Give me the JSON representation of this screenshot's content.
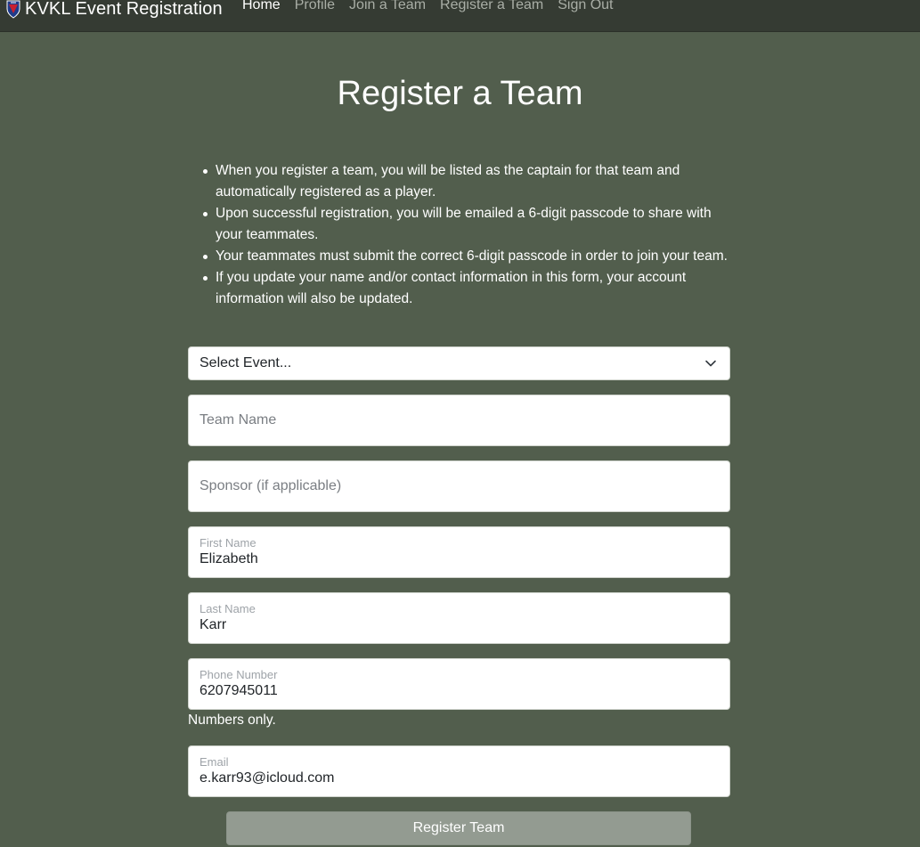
{
  "navbar": {
    "brand": "KVKL Event Registration",
    "links": [
      {
        "label": "Home",
        "active": true
      },
      {
        "label": "Profile"
      },
      {
        "label": "Join a Team"
      },
      {
        "label": "Register a Team"
      },
      {
        "label": "Sign Out"
      }
    ]
  },
  "page": {
    "title": "Register a Team",
    "info": [
      "When you register a team, you will be listed as the captain for that team and automatically registered as a player.",
      "Upon successful registration, you will be emailed a 6-digit passcode to share with your teammates.",
      "Your teammates must submit the correct 6-digit passcode in order to join your team.",
      "If you update your name and/or contact information in this form, your account information will also be updated."
    ]
  },
  "form": {
    "event_select": {
      "selected": "Select Event..."
    },
    "team_name": {
      "placeholder": "Team Name",
      "value": ""
    },
    "sponsor": {
      "placeholder": "Sponsor (if applicable)",
      "value": ""
    },
    "first_name": {
      "label": "First Name",
      "value": "Elizabeth"
    },
    "last_name": {
      "label": "Last Name",
      "value": "Karr"
    },
    "phone": {
      "label": "Phone Number",
      "value": "6207945011",
      "helper": "Numbers only."
    },
    "email": {
      "label": "Email",
      "value": "e.karr93@icloud.com"
    },
    "submit_label": "Register Team"
  },
  "icons": {
    "brand_logo": "shield-logo-icon",
    "select_arrow": "chevron-down-icon"
  },
  "colors": {
    "background": "#525e4d",
    "navbar": "#353b33",
    "button": "#939b91"
  }
}
